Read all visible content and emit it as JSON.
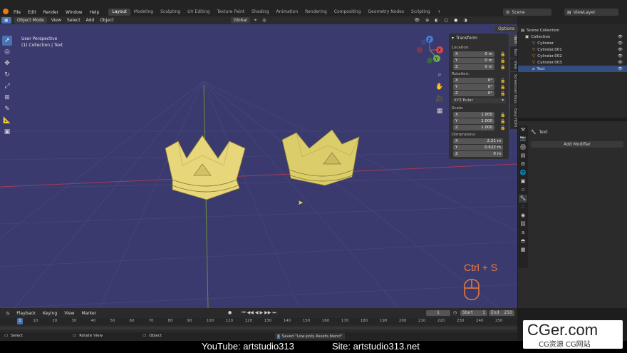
{
  "menu": {
    "items": [
      "File",
      "Edit",
      "Render",
      "Window",
      "Help"
    ],
    "workspaces": [
      "Layout",
      "Modeling",
      "Sculpting",
      "UV Editing",
      "Texture Paint",
      "Shading",
      "Animation",
      "Rendering",
      "Compositing",
      "Geometry Nodes",
      "Scripting"
    ],
    "active_workspace": "Layout",
    "add_tab": "+",
    "scene": "Scene",
    "view_layer": "ViewLayer"
  },
  "viewport_header": {
    "mode": "Object Mode",
    "menus": [
      "View",
      "Select",
      "Add",
      "Object"
    ],
    "transform_orientation": "Global",
    "options": "Options"
  },
  "viewport_info": {
    "view_name": "User Perspective",
    "collection_text": "(1) Collection | Text"
  },
  "gizmo": {
    "x": "X",
    "y": "Y",
    "z": "Z"
  },
  "npanel": {
    "title": "Transform",
    "location_label": "Location:",
    "location": [
      {
        "axis": "X",
        "value": "0 m"
      },
      {
        "axis": "Y",
        "value": "0 m"
      },
      {
        "axis": "Z",
        "value": "0 m"
      }
    ],
    "rotation_label": "Rotation:",
    "rotation": [
      {
        "axis": "X",
        "value": "0°"
      },
      {
        "axis": "Y",
        "value": "0°"
      },
      {
        "axis": "Z",
        "value": "0°"
      }
    ],
    "rotation_mode": "XYZ Euler",
    "scale_label": "Scale:",
    "scale": [
      {
        "axis": "X",
        "value": "1.000"
      },
      {
        "axis": "Y",
        "value": "1.000"
      },
      {
        "axis": "Z",
        "value": "1.000"
      }
    ],
    "dimensions_label": "Dimensions:",
    "dimensions": [
      {
        "axis": "X",
        "value": "2.21 m"
      },
      {
        "axis": "Y",
        "value": "0.622 m"
      },
      {
        "axis": "Z",
        "value": "0 m"
      }
    ],
    "tabs": [
      "Item",
      "Tool",
      "View",
      "Screencast Keys",
      "Easy HDRI"
    ]
  },
  "outliner": {
    "rows": [
      "Scene Collection",
      "Collection",
      "Cylinder",
      "Cylinder.001",
      "Cylinder.002",
      "Cylinder.003",
      "Text"
    ]
  },
  "properties": {
    "object_name": "Text",
    "add_modifier": "Add Modifier"
  },
  "timeline": {
    "menus": [
      "Playback",
      "Keying",
      "View",
      "Marker"
    ],
    "current_frame": "1",
    "start_label": "Start",
    "start": "1",
    "end_label": "End",
    "end": "250",
    "ticks": [
      "1",
      "10",
      "20",
      "30",
      "40",
      "50",
      "60",
      "70",
      "80",
      "90",
      "100",
      "110",
      "120",
      "130",
      "140",
      "150",
      "160",
      "170",
      "180",
      "190",
      "200",
      "210",
      "220",
      "230",
      "240",
      "250"
    ]
  },
  "status": {
    "select": "Select",
    "rotate": "Rotate View",
    "object": "Object",
    "message": "Saved \"Low-poly Assets.blend\""
  },
  "overlay": {
    "shortcut": "Ctrl + S"
  },
  "caption": {
    "youtube": "YouTube: artstudio313",
    "site": "Site: artstudio313.net"
  },
  "watermark": {
    "main": "CGer.com",
    "sub": "CG资源 CG网站"
  },
  "colors": {
    "viewport_bg": "#3a3a6e",
    "crown": "#e8d67a",
    "accent": "#4772b3",
    "shortcut": "#f07a3a"
  }
}
